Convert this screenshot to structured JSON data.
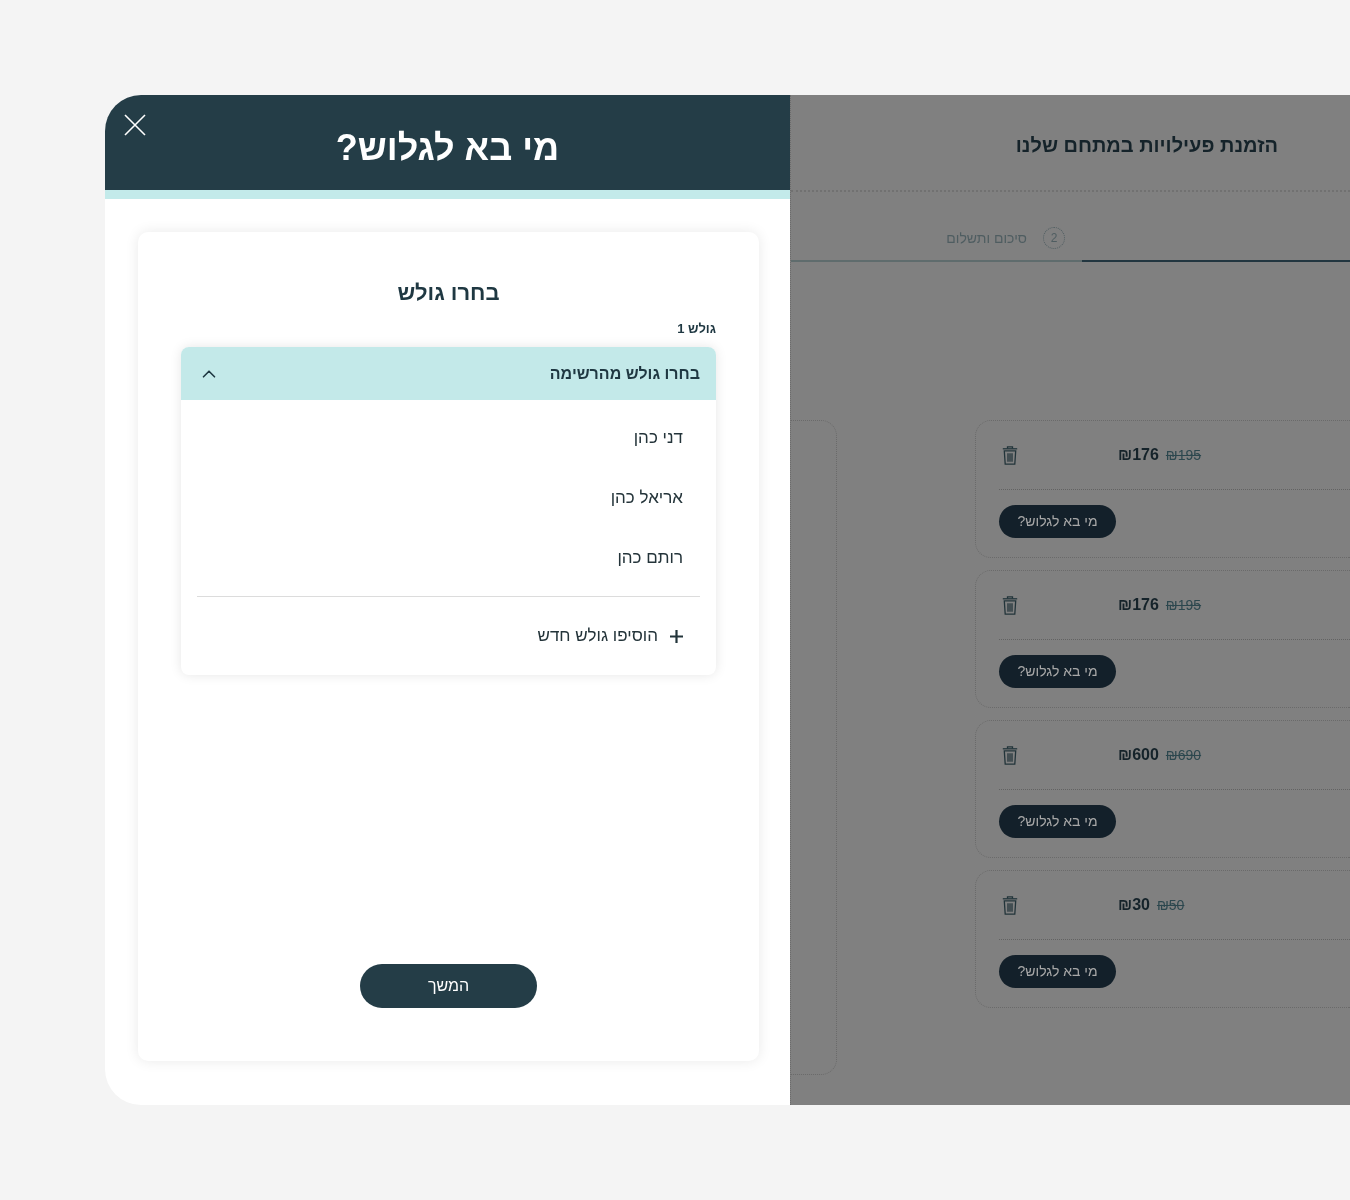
{
  "dialog": {
    "title": "מי בא לגלוש?",
    "heading": "בחרו גולש",
    "surfer_label": "גולש 1",
    "dropdown": {
      "placeholder": "בחרו גולש מהרשימה",
      "expanded": true,
      "options": [
        {
          "label": "דני כהן",
          "selected": false
        },
        {
          "label": "אריאל כהן",
          "selected": false
        },
        {
          "label": "רותם כהן",
          "selected": false
        }
      ],
      "add_label": "הוסיפו גולש חדש"
    },
    "continue_button": "המשך"
  },
  "background_page": {
    "title": "הזמנת פעילויות במתחם שלנו",
    "steps": [
      {
        "number": "2",
        "label": "סיכום ותשלום",
        "selected": false
      }
    ],
    "progress": {
      "level": 0.48
    },
    "items": [
      {
        "price": "₪176",
        "old_price": "₪195",
        "button": "מי בא לגלוש?"
      },
      {
        "price": "₪176",
        "old_price": "₪195",
        "button": "מי בא לגלוש?"
      },
      {
        "price": "₪600",
        "old_price": "₪690",
        "button": "מי בא לגלוש?"
      },
      {
        "price": "₪30",
        "old_price": "₪50",
        "button": "מי בא לגלוש?"
      }
    ]
  }
}
